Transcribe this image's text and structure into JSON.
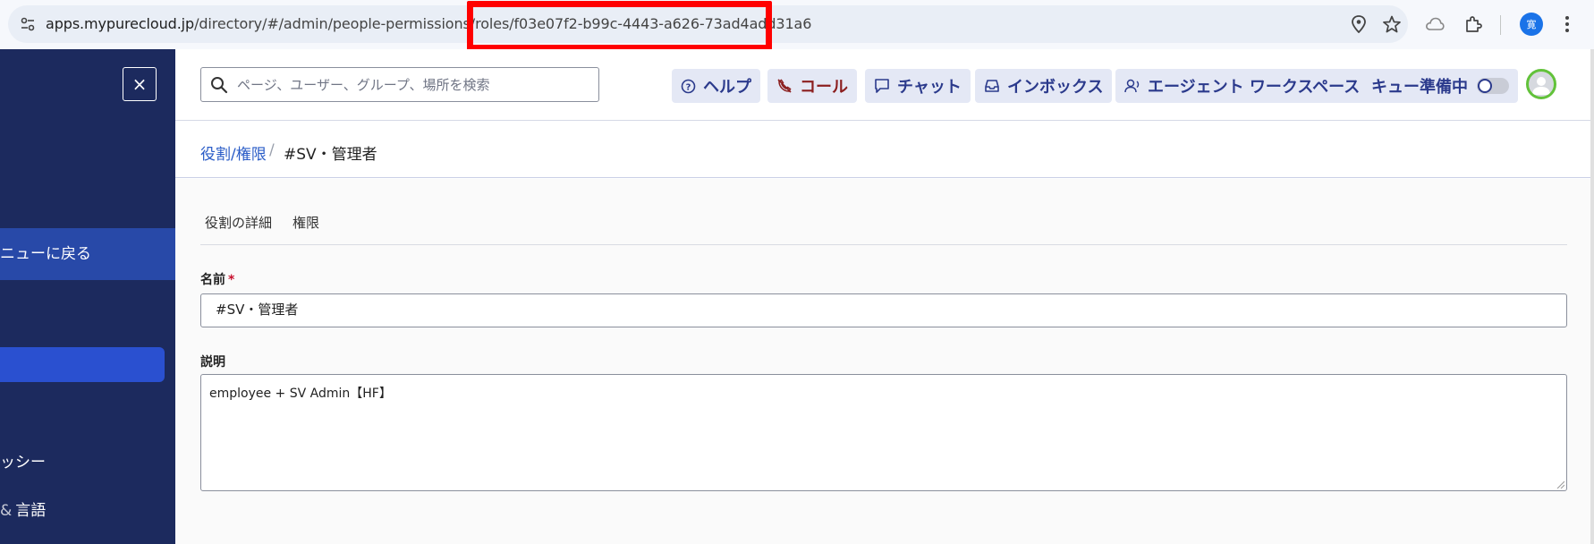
{
  "browser": {
    "url_host": "apps.mypurecloud.jp",
    "url_path": "/directory/#/admin/people-permissions/roles/f03e07f2-b99c-4443-a626-73ad4add31a6",
    "profile_initial": "寛"
  },
  "sidebar": {
    "close_label": "×",
    "back_label": "ニューに戻る",
    "item_policy": "ッシー",
    "item_language": "言語"
  },
  "header": {
    "search_placeholder": "ページ、ユーザー、グループ、場所を検索",
    "help_label": "ヘルプ",
    "call_label": "コール",
    "chat_label": "チャット",
    "inbox_label": "インボックス",
    "workspace_label": "エージェント ワークスペース",
    "queue_label": "キュー準備中"
  },
  "breadcrumb": {
    "parent": "役割/権限",
    "separator": "/",
    "current": "#SV・管理者"
  },
  "tabs": {
    "details": "役割の詳細",
    "permissions": "権限"
  },
  "form": {
    "name_label": "名前",
    "required_mark": "*",
    "name_value": "#SV・管理者",
    "description_label": "説明",
    "description_value": "employee + SV Admin【HF】"
  }
}
